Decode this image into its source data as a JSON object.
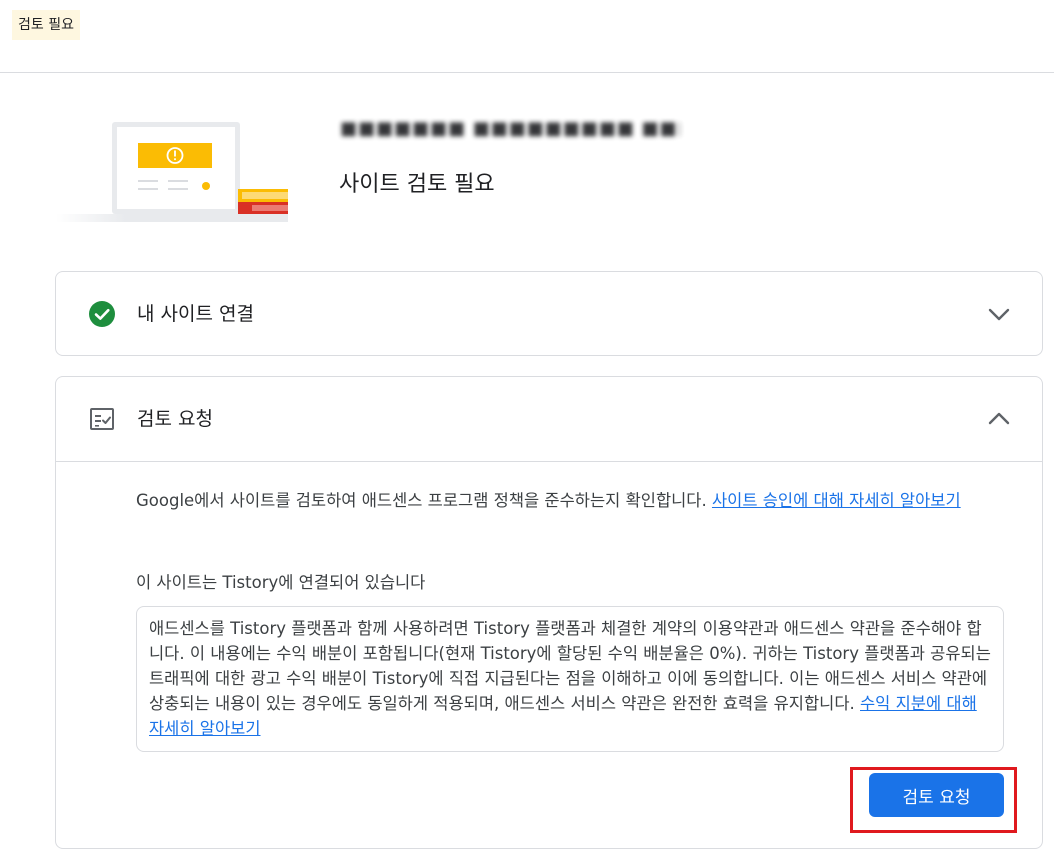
{
  "header": {
    "status_chip": "검토 필요"
  },
  "site": {
    "name_redacted": "■■■■■■■ ■■■■■■■■■ ■■■■",
    "status": "사이트 검토 필요"
  },
  "steps": [
    {
      "title": "내 사이트 연결",
      "state": "complete",
      "icon": "check-circle-icon",
      "expanded": false
    },
    {
      "title": "검토 요청",
      "state": "current",
      "icon": "checklist-icon",
      "expanded": true
    }
  ],
  "review": {
    "intro": "Google에서 사이트를 검토하여 애드센스 프로그램 정책을 준수하는지 확인합니다. ",
    "intro_link": "사이트 승인에 대해 자세히 알아보기",
    "connected_text": "이 사이트는 Tistory에 연결되어 있습니다",
    "terms": "애드센스를 Tistory 플랫폼과 함께 사용하려면 Tistory 플랫폼과 체결한 계약의 이용약관과 애드센스 약관을 준수해야 합니다. 이 내용에는 수익 배분이 포함됩니다(현재 Tistory에 할당된 수익 배분율은 0%). 귀하는 Tistory 플랫폼과 공유되는 트래픽에 대한 광고 수익 배분이 Tistory에 직접 지급된다는 점을 이해하고 이에 동의합니다. 이는 애드센스 서비스 약관에 상충되는 내용이 있는 경우에도 동일하게 적용되며, 애드센스 서비스 약관은 완전한 효력을 유지합니다. ",
    "terms_link": "수익 지분에 대해 자세히 알아보기",
    "button_label": "검토 요청"
  },
  "colors": {
    "primary": "#1a73e8",
    "success": "#1e8e3e",
    "warning": "#fbbc04",
    "highlight": "#e0191e",
    "chip_bg": "#fef7e0"
  }
}
